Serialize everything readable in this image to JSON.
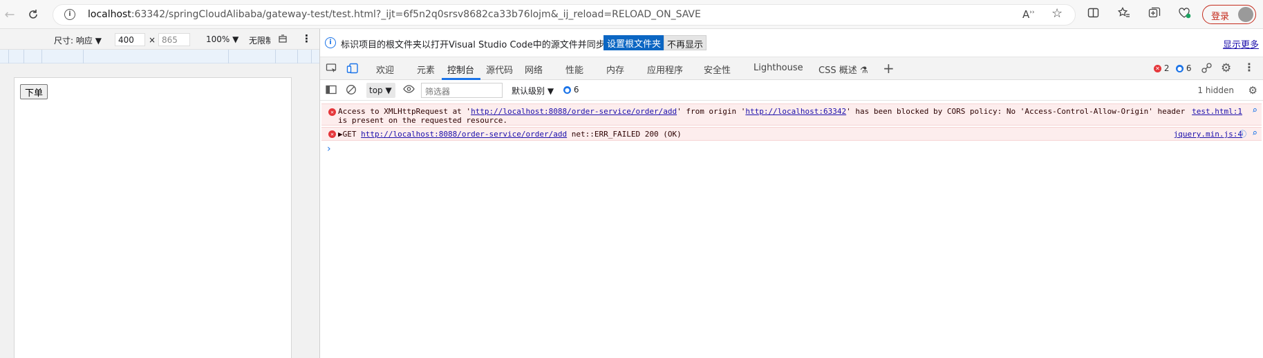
{
  "browser": {
    "url_host": "localhost",
    "url_rest": ":63342/springCloudAlibaba/gateway-test/test.html?_ijt=6f5n2q0srsv8682ca33b76lojm&_ij_reload=RELOAD_ON_SAVE",
    "login_label": "登录"
  },
  "device": {
    "size_label": "尺寸: 响应",
    "width": "400",
    "times": "×",
    "height": "865",
    "zoom": "100%",
    "throttle": "无限制"
  },
  "page": {
    "order_button": "下单"
  },
  "infobar": {
    "message": "标识项目的根文件夹以打开Visual Studio Code中的源文件并同步更改。",
    "set_root": "设置根文件夹",
    "dont_show": "不再显示",
    "show_more": "显示更多"
  },
  "tabs": [
    {
      "label": "欢迎"
    },
    {
      "label": "元素"
    },
    {
      "label": "控制台"
    },
    {
      "label": "源代码"
    },
    {
      "label": "网络"
    },
    {
      "label": "性能"
    },
    {
      "label": "内存"
    },
    {
      "label": "应用程序"
    },
    {
      "label": "安全性"
    },
    {
      "label": "Lighthouse"
    },
    {
      "label": "CSS 概述"
    }
  ],
  "counts": {
    "errors": "2",
    "messages": "6"
  },
  "filter": {
    "context": "top",
    "placeholder": "筛选器",
    "level": "默认级别",
    "message_count": "6",
    "hidden": "1 hidden"
  },
  "console": {
    "error1": {
      "prefix": "Access to XMLHttpRequest at '",
      "url1": "http://localhost:8088/order-service/order/add",
      "mid": "' from origin '",
      "url2": "http://localhost:63342",
      "suffix": "' has been blocked by CORS policy: No 'Access-Control-Allow-Origin' header",
      "line2": "is present on the requested resource.",
      "source": "test.html:1"
    },
    "error2": {
      "method": "GET",
      "url": "http://localhost:8088/order-service/order/add",
      "status": "net::ERR_FAILED 200 (OK)",
      "source": "jquery.min.js:4"
    }
  },
  "colors": {
    "accent": "#1a73e8",
    "error": "#e5363a",
    "login": "#c42b1c"
  }
}
